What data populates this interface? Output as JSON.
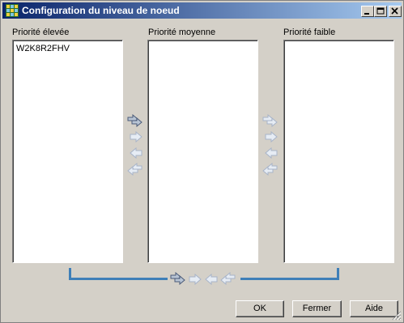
{
  "window": {
    "title": "Configuration du niveau de noeud",
    "controls": [
      "minimize-icon",
      "maximize-icon",
      "close-icon"
    ]
  },
  "columns": {
    "high": {
      "label": "Priorité élevée",
      "items": [
        "W2K8R2FHV"
      ]
    },
    "medium": {
      "label": "Priorité moyenne",
      "items": []
    },
    "low": {
      "label": "Priorité faible",
      "items": []
    }
  },
  "move_arrows": {
    "left_group": [
      "move-all-right-icon",
      "move-right-icon",
      "move-left-icon",
      "move-all-left-icon"
    ],
    "right_group": [
      "move-all-right-icon",
      "move-right-icon",
      "move-left-icon",
      "move-all-left-icon"
    ],
    "bottom_group": [
      "move-all-right-icon",
      "move-right-icon",
      "move-left-icon",
      "move-all-left-icon"
    ]
  },
  "buttons": {
    "ok": "OK",
    "close": "Fermer",
    "help": "Aide"
  },
  "colors": {
    "title_gradient_start": "#0a246a",
    "title_gradient_end": "#a6caf0",
    "connector": "#3f7fb8",
    "dialog_bg": "#d4d0c8"
  }
}
